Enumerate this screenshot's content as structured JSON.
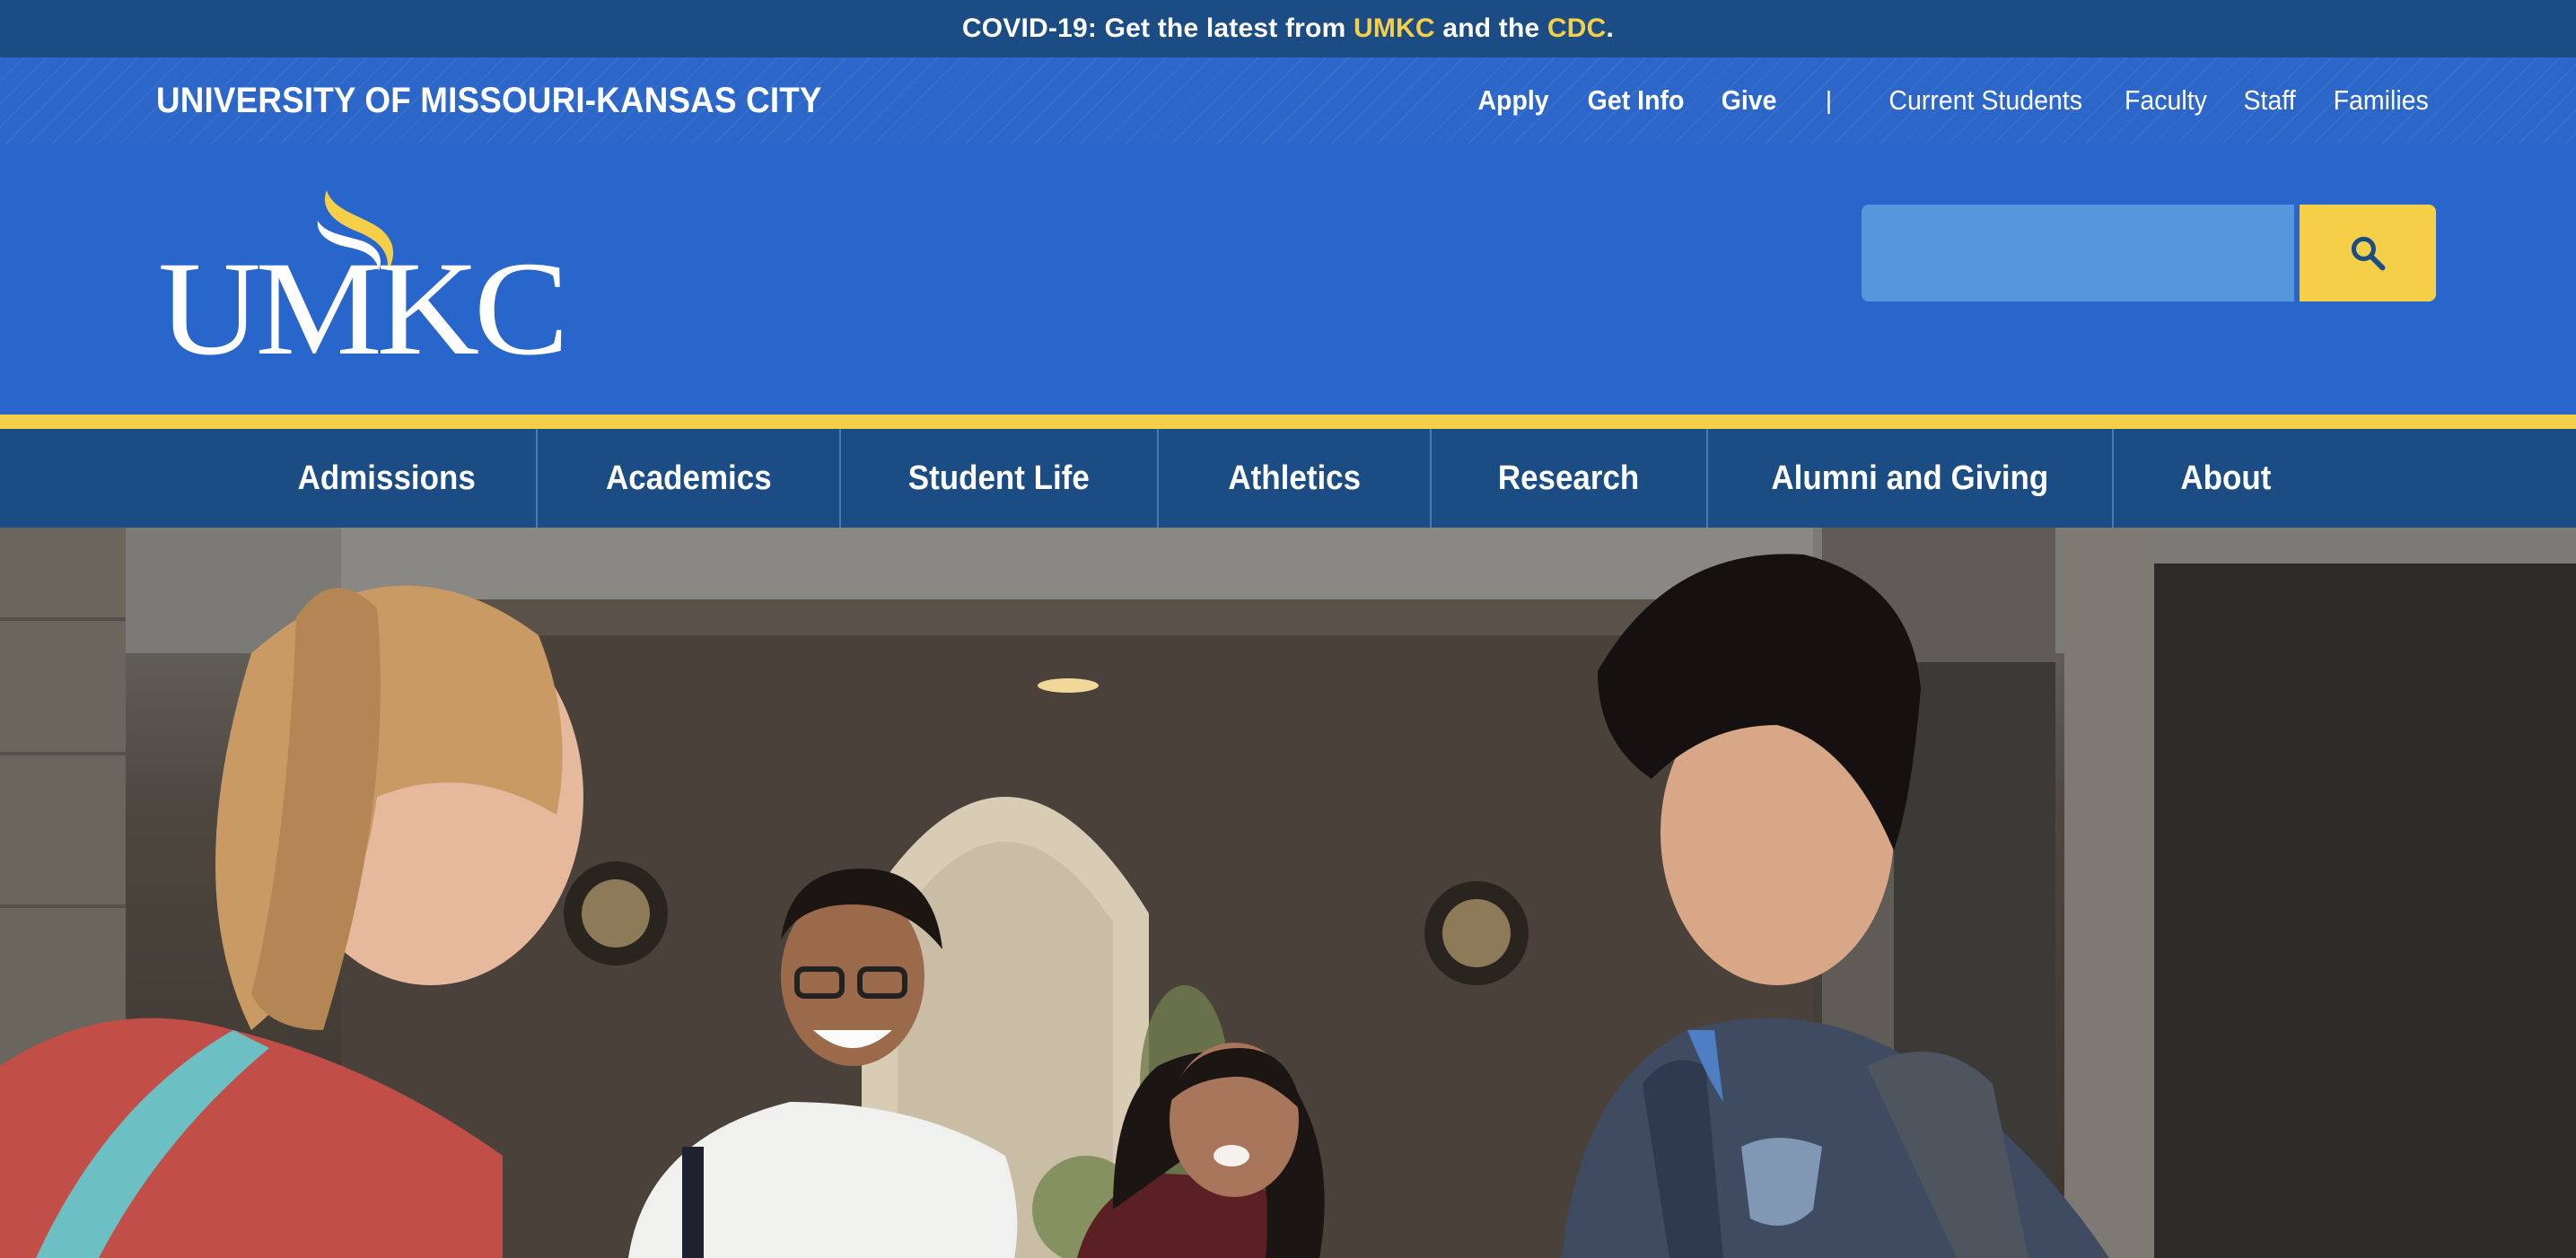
{
  "covid_bar": {
    "prefix": "COVID-19: Get the latest from ",
    "link1": "UMKC",
    "middle": " and the ",
    "link2": "CDC",
    "suffix": "."
  },
  "utility_bar": {
    "university_name": "UNIVERSITY OF MISSOURI-KANSAS CITY",
    "primary_links": [
      "Apply",
      "Get Info",
      "Give"
    ],
    "separator": "|",
    "audience_links": [
      "Current Students",
      "Faculty",
      "Staff",
      "Families"
    ]
  },
  "masthead": {
    "logo_text": "UMKC",
    "search": {
      "placeholder": "",
      "value": "",
      "icon": "search-icon"
    }
  },
  "main_nav": {
    "items": [
      "Admissions",
      "Academics",
      "Student Life",
      "Athletics",
      "Research",
      "Alumni and Giving",
      "About"
    ]
  },
  "hero": {
    "icon": "students-photo"
  },
  "colors": {
    "navy": "#1c4c84",
    "blue": "#2966cb",
    "gold": "#f5cf47",
    "search_field": "#5597dc"
  }
}
